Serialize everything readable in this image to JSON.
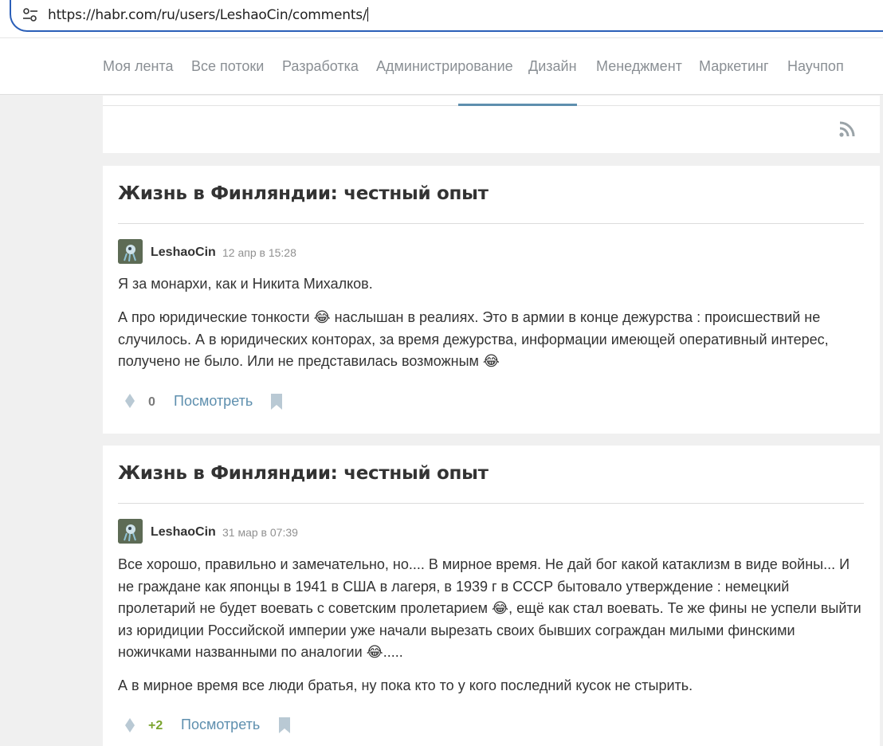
{
  "browser": {
    "url": "https://habr.com/ru/users/LeshaoCin/comments/",
    "site_info_icon": "tune-icon"
  },
  "nav": {
    "items": [
      "Моя лента",
      "Все потоки",
      "Разработка",
      "Администрирование",
      "Дизайн",
      "Менеджмент",
      "Маркетинг",
      "Научпоп"
    ]
  },
  "feed": {
    "rss_icon": "rss-icon"
  },
  "comments": [
    {
      "post_title": "Жизнь в Финляндии: честный опыт",
      "author": "LeshaoCin",
      "date": "12 апр в 15:28",
      "p1": "Я за монархи, как и Никита Михалков.",
      "p2_a": "А про юридические тонкости ",
      "emoji": "😂",
      "p2_b": " наслышан в реалиях. Это в армии в конце дежурства : происшествий не случилось. А в юридических конторах, за время дежурства, информации имеющей оперативный интерес, получено не было. Или не представилась возможным ",
      "score": "0",
      "view_label": "Посмотреть"
    },
    {
      "post_title": "Жизнь в Финляндии: честный опыт",
      "author": "LeshaoCin",
      "date": "31 мар в 07:39",
      "p1_a": "Все хорошо, правильно и замечательно, но.... В мирное время. Не дай бог какой катаклизм в виде войны... И не граждане как японцы в 1941 в США в лагеря, в 1939 г в СССР бытовало утверждение : немецкий пролетарий не будет воевать с советским пролетарием ",
      "emoji": "😂",
      "p1_b": ", ещё как стал воевать. Те же фины не успели выйти из юридиции Российской империи уже начали вырезать своих бывших сограждан милыми финскими ножичками названными по аналогии ",
      "p1_c": ".....",
      "p2": "А в мирное время все люди братья, ну пока кто то у кого последний кусок не стырить.",
      "score": "+2",
      "view_label": "Посмотреть"
    }
  ],
  "colors": {
    "accent": "#5e8fae",
    "positive_score": "#7ba42e",
    "url_focus_border": "#2b5fb8"
  }
}
